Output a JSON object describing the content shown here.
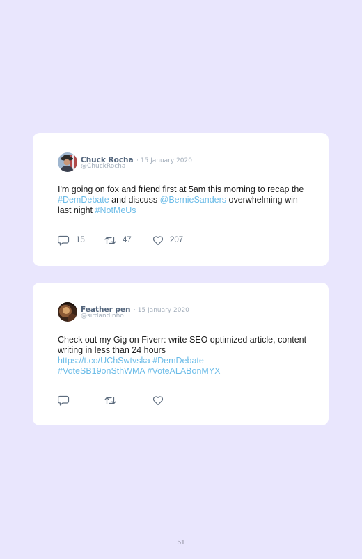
{
  "tweets": [
    {
      "name": "Chuck Rocha",
      "date": "· 15 January 2020",
      "handle": "@ChuckRocha",
      "text": {
        "t1": "I'm going on fox and friend first at 5am this morning to recap the ",
        "l1": "#DemDebate",
        "t2": " and discuss ",
        "l2": "@BernieSanders",
        "t3": " overwhelming win last night ",
        "l3": "#NotMeUs"
      },
      "replies": "15",
      "retweets": "47",
      "likes": "207"
    },
    {
      "name": "Feather pen",
      "date": "· 15 January 2020",
      "handle": "@sirdandinho",
      "text": {
        "t1": "Check out my Gig on Fiverr: write SEO optimized article, content writing in less than 24 hours",
        "l1": "https://t.co/UChSwtvska",
        "l2": "#DemDebate",
        "l3": "#VoteSB19onSthWMA",
        "l4": "#VoteALABonMYX"
      }
    }
  ],
  "icons": {
    "reply": "reply-icon",
    "retweet": "retweet-icon",
    "like": "heart-icon"
  },
  "colors": {
    "background": "#e9e6fd",
    "card": "#ffffff",
    "link": "#6cbce8"
  },
  "page_number": "51"
}
